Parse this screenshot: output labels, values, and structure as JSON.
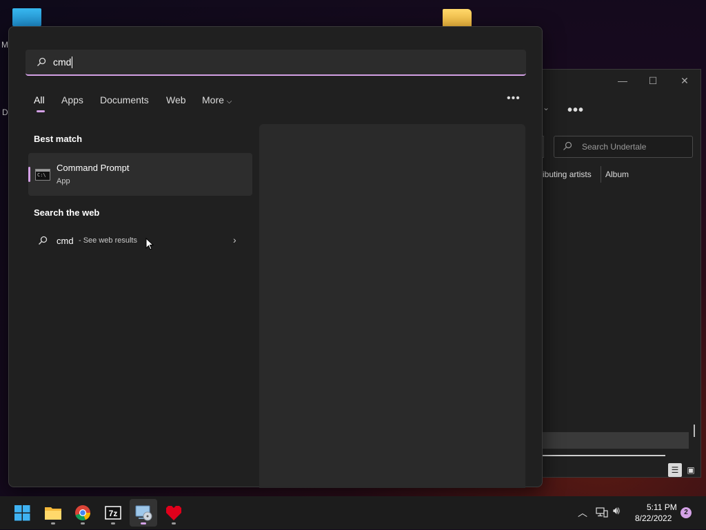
{
  "desktop": {
    "icons": [
      {
        "name": "monitor-icon",
        "label_fragment": "M"
      },
      {
        "name": "folder-icon",
        "label_fragment": ""
      }
    ],
    "side_fragment": "Da"
  },
  "bg_window": {
    "search_placeholder": "Search Undertale",
    "columns": [
      "ributing artists",
      "Album"
    ],
    "controls": {
      "minimize": "—",
      "maximize": "☐",
      "close": "✕"
    },
    "more": "•••"
  },
  "search": {
    "query": "cmd",
    "tabs": [
      "All",
      "Apps",
      "Documents",
      "Web",
      "More"
    ],
    "active_tab": "All",
    "menu": "•••",
    "best_match": {
      "title": "Best match",
      "name": "Command Prompt",
      "type": "App",
      "icon": "command-prompt-icon"
    },
    "web": {
      "title": "Search the web",
      "query": "cmd",
      "suffix": "- See web results"
    }
  },
  "taskbar": {
    "apps": [
      "start-icon",
      "file-explorer-icon",
      "chrome-icon",
      "7zip-icon",
      "media-player-icon",
      "undertale-heart-icon"
    ],
    "tray": {
      "time": "5:11 PM",
      "date": "8/22/2022",
      "notifications": "2"
    }
  },
  "colors": {
    "accent": "#d4a1e6",
    "panel": "#202020",
    "taskbar": "#1c1c1c"
  }
}
